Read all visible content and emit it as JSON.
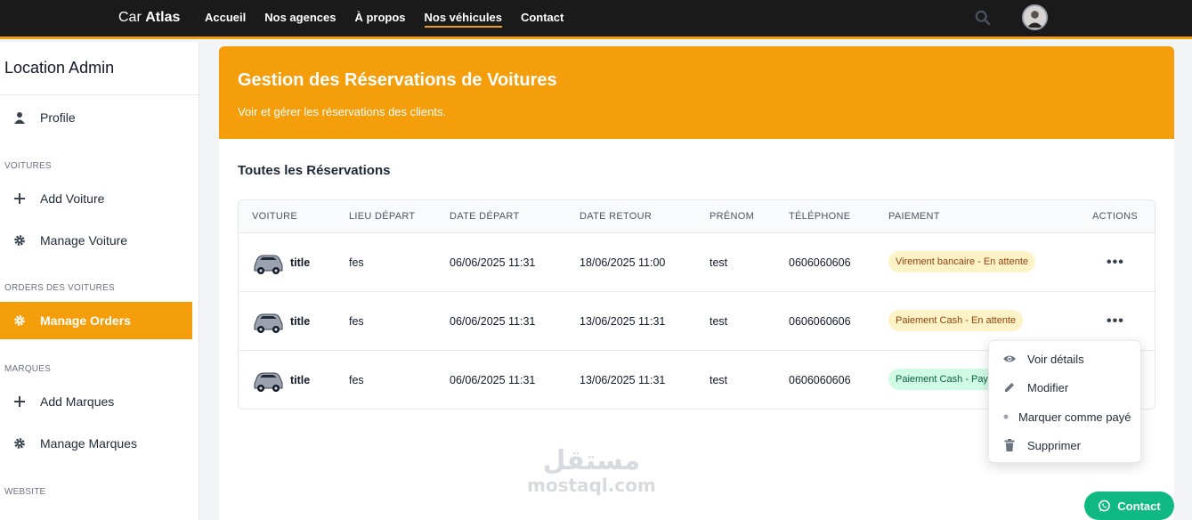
{
  "nav": {
    "brand_prefix": "Car",
    "brand_bold": "Atlas",
    "links": [
      "Accueil",
      "Nos agences",
      "À propos",
      "Nos véhicules",
      "Contact"
    ],
    "active_link": "Nos véhicules"
  },
  "sidebar": {
    "title": "Location Admin",
    "profile": "Profile",
    "sections": {
      "voitures": "VOITURES",
      "orders": "ORDERS DES VOITURES",
      "marques": "MARQUES",
      "website": "WEBSITE"
    },
    "items": {
      "add_voiture": "Add Voiture",
      "manage_voiture": "Manage Voiture",
      "manage_orders": "Manage Orders",
      "add_marques": "Add Marques",
      "manage_marques": "Manage Marques"
    }
  },
  "header": {
    "title": "Gestion des Réservations de Voitures",
    "subtitle": "Voir et gérer les réservations des clients."
  },
  "table": {
    "title": "Toutes les Réservations",
    "columns": [
      "VOITURE",
      "LIEU DÉPART",
      "DATE DÉPART",
      "DATE RETOUR",
      "PRÉNOM",
      "TÉLÉPHONE",
      "PAIEMENT",
      "ACTIONS"
    ],
    "rows": [
      {
        "voiture": "title",
        "lieu": "fes",
        "depart": "06/06/2025 11:31",
        "retour": "18/06/2025 11:00",
        "prenom": "test",
        "telephone": "0606060606",
        "paiement": "Virement bancaire - En attente",
        "status": "pending"
      },
      {
        "voiture": "title",
        "lieu": "fes",
        "depart": "06/06/2025 11:31",
        "retour": "13/06/2025 11:31",
        "prenom": "test",
        "telephone": "0606060606",
        "paiement": "Paiement Cash - En attente",
        "status": "pending"
      },
      {
        "voiture": "title",
        "lieu": "fes",
        "depart": "06/06/2025 11:31",
        "retour": "13/06/2025 11:31",
        "prenom": "test",
        "telephone": "0606060606",
        "paiement": "Paiement Cash - Payé",
        "status": "paid"
      }
    ]
  },
  "dropdown": {
    "view": "Voir détails",
    "edit": "Modifier",
    "mark_paid": "Marquer comme payé",
    "delete": "Supprimer"
  },
  "watermark": {
    "arabic": "مستقل",
    "latin": "mostaql.com"
  },
  "contact_button": "Contact",
  "colors": {
    "accent": "#f59e0b",
    "nav_bg": "#1a1a1a",
    "success": "#10b981"
  }
}
